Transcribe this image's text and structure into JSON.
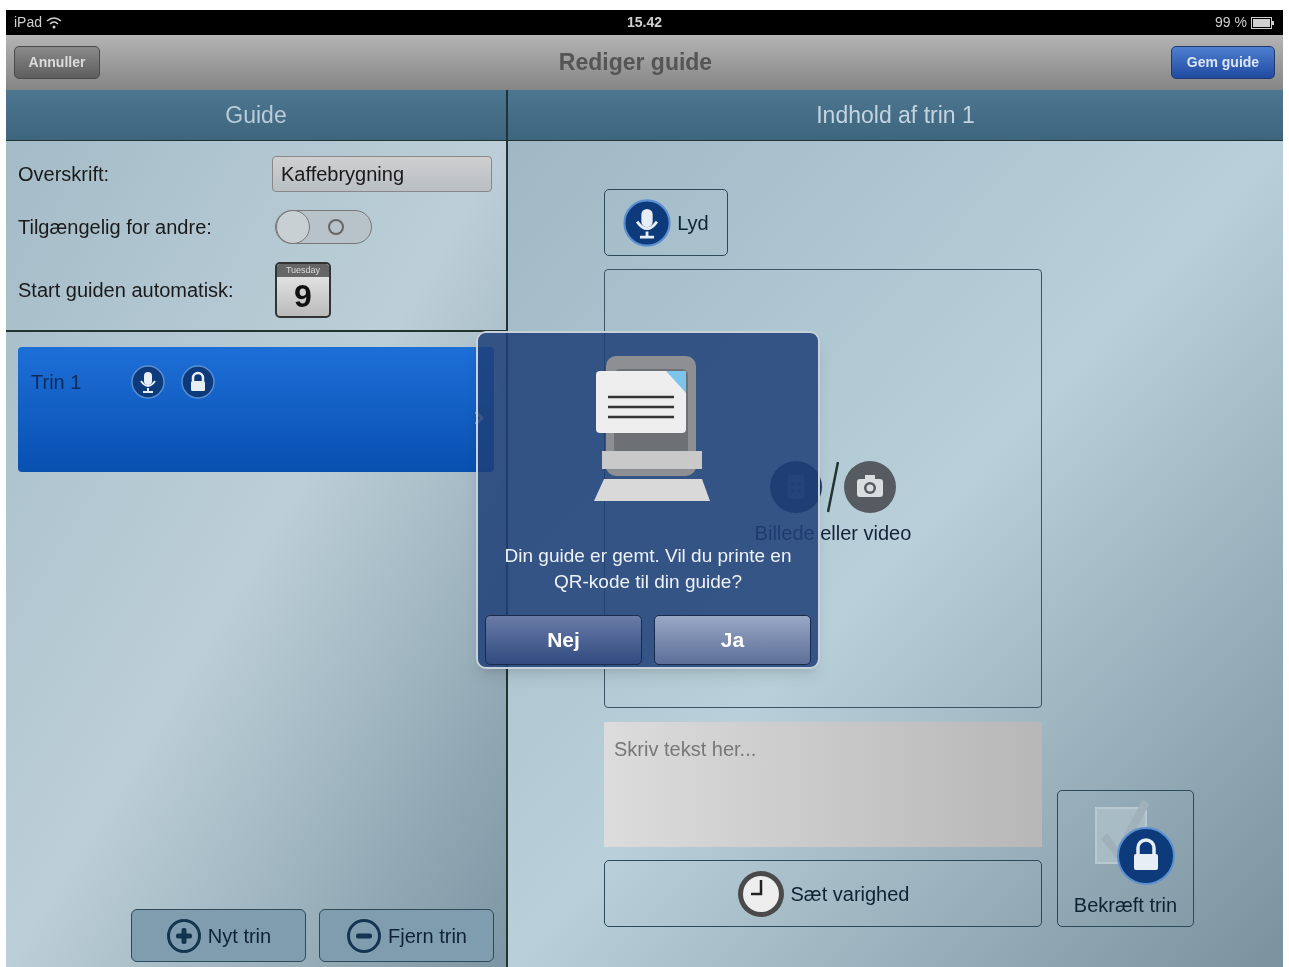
{
  "status_bar": {
    "device": "iPad",
    "time": "15.42",
    "battery": "99 %"
  },
  "nav_bar": {
    "cancel": "Annuller",
    "title": "Rediger guide",
    "save": "Gem guide"
  },
  "left_header": "Guide",
  "right_header": "Indhold af trin 1",
  "form": {
    "heading_label": "Overskrift:",
    "heading_value": "Kaffebrygning",
    "shared_label": "Tilgængelig for andre:",
    "shared_on": false,
    "autostart_label": "Start guiden automatisk:",
    "calendar_day": "Tuesday",
    "calendar_date": "9"
  },
  "steps": [
    {
      "label": "Trin 1",
      "selected": true
    }
  ],
  "step_buttons": [
    {
      "kind": "add",
      "label": "Nyt trin"
    },
    {
      "kind": "remove",
      "label": "Fjern trin"
    }
  ],
  "content": {
    "sound_button": "Lyd",
    "media_label": "Billede eller video",
    "text_placeholder": "Skriv tekst her...",
    "duration_button": "Sæt varighed",
    "confirm_button": "Bekræft trin"
  },
  "dialog": {
    "message": "Din guide er gemt. Vil du printe en QR-kode til din guide?",
    "buttons": [
      {
        "label": "Nej",
        "selected": false
      },
      {
        "label": "Ja",
        "selected": true
      }
    ]
  }
}
